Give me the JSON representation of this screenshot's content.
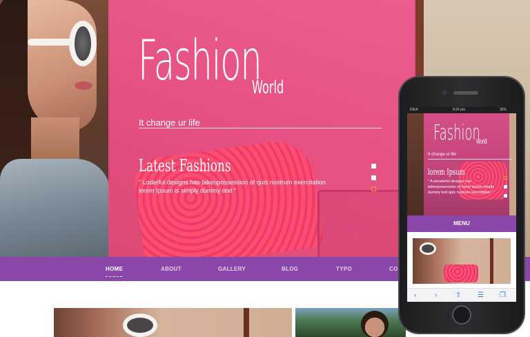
{
  "hero": {
    "title": "Fashion",
    "title_suffix": "World",
    "tagline": "It change ur life",
    "section_title": "Latest Fashions",
    "section_desc": "\" Loderful designs has takenpossession of quis nostrum exercitation lorem Ipsum is simply dummy text \"",
    "slider_active_index": 3
  },
  "nav": {
    "items": [
      {
        "label": "HOME",
        "active": true
      },
      {
        "label": "ABOUT"
      },
      {
        "label": "GALLERY"
      },
      {
        "label": "BLOG"
      },
      {
        "label": "TYPO"
      },
      {
        "label": "CON"
      }
    ]
  },
  "phone": {
    "status_carrier": "IDEA",
    "status_time": "8:26 pm",
    "status_battery": "36%",
    "title": "Fashion",
    "title_suffix": "World",
    "tagline": "It change ur life",
    "section_title": "lorem Ipsum",
    "section_desc": "\" A wonderful designs has takenpossession of lorem Ipsum simply dummy text quis nostrum exercitation \"",
    "menu_label": "MENU",
    "toolbar_icons": [
      "back-icon",
      "forward-icon",
      "share-icon",
      "bookmarks-icon",
      "tabs-icon"
    ]
  },
  "colors": {
    "pink_overlay": "#ea4a82",
    "nav_purple": "#8a46a8",
    "slider_active": "#ff9a3c"
  }
}
